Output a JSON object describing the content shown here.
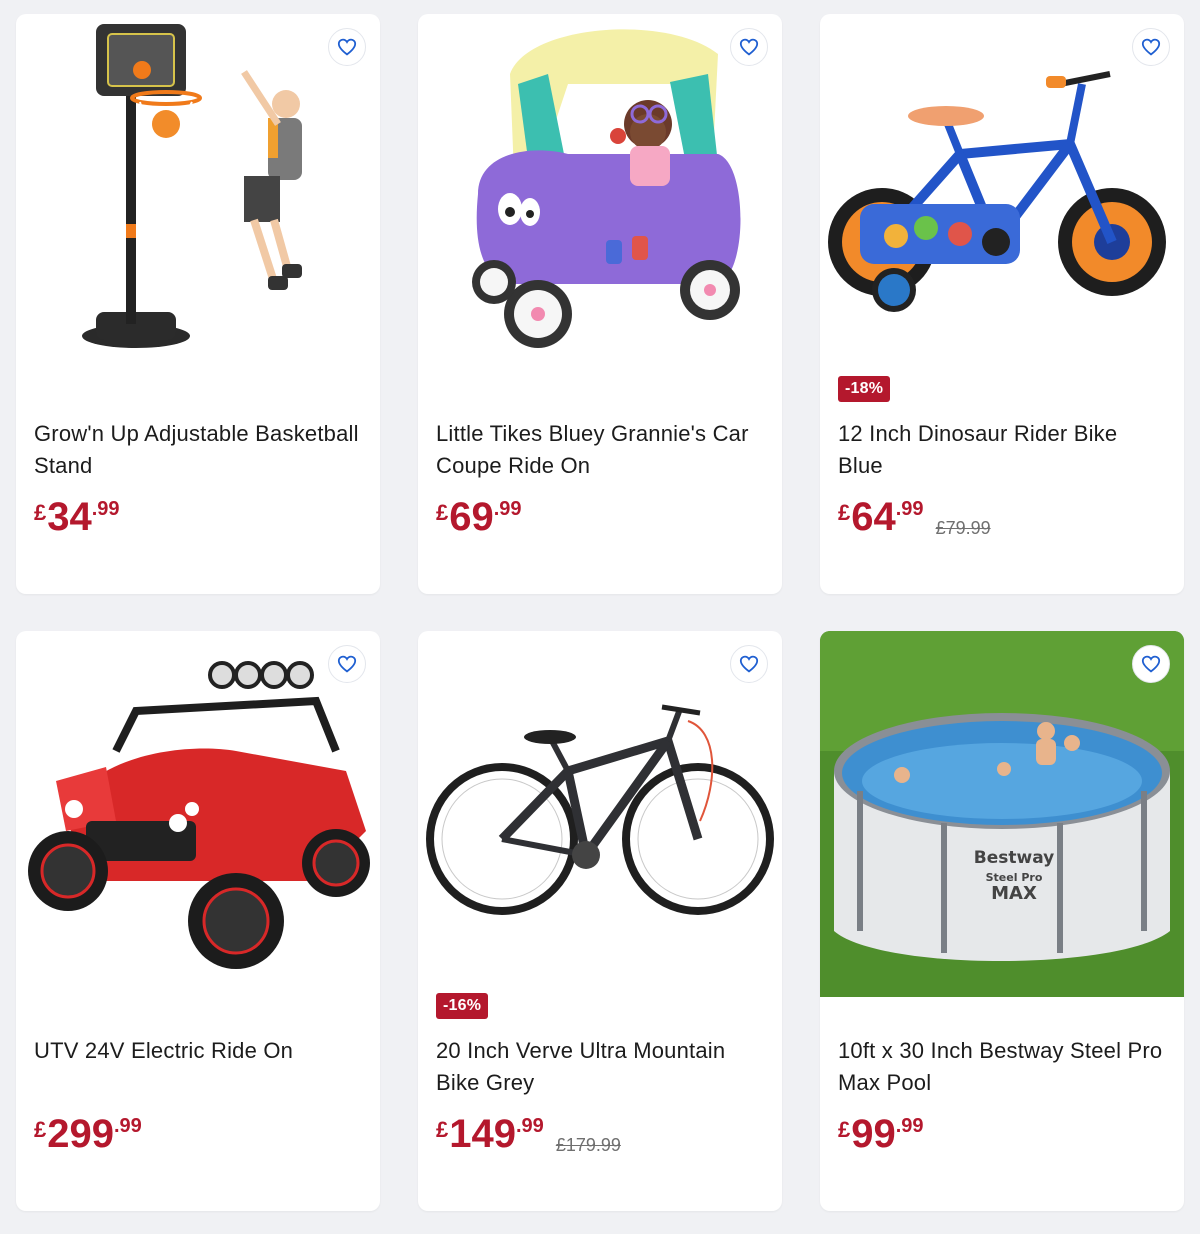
{
  "products": [
    {
      "title": "Grow'n Up Adjustable Basketball Stand",
      "currency": "£",
      "price_main": "34",
      "price_pence": ".99",
      "was_price": "",
      "badge": ""
    },
    {
      "title": "Little Tikes Bluey Grannie's Car Coupe Ride On",
      "currency": "£",
      "price_main": "69",
      "price_pence": ".99",
      "was_price": "",
      "badge": ""
    },
    {
      "title": "12 Inch Dinosaur Rider Bike Blue",
      "currency": "£",
      "price_main": "64",
      "price_pence": ".99",
      "was_price": "£79.99",
      "badge": "-18%"
    },
    {
      "title": "UTV 24V Electric Ride On",
      "currency": "£",
      "price_main": "299",
      "price_pence": ".99",
      "was_price": "",
      "badge": ""
    },
    {
      "title": "20 Inch Verve Ultra Mountain Bike Grey",
      "currency": "£",
      "price_main": "149",
      "price_pence": ".99",
      "was_price": "£179.99",
      "badge": "-16%"
    },
    {
      "title": "10ft x 30 Inch Bestway Steel Pro Max Pool",
      "currency": "£",
      "price_main": "99",
      "price_pence": ".99",
      "was_price": "",
      "badge": ""
    }
  ],
  "images": {
    "pool_brand": "Bestway",
    "pool_line": "Steel Pro",
    "pool_model": "MAX"
  },
  "icons": {
    "favourite": "heart-outline-icon"
  },
  "colors": {
    "price": "#b4182d",
    "badge": "#b4182d",
    "heart": "#1f5fd1",
    "page_bg": "#f0f1f4"
  }
}
